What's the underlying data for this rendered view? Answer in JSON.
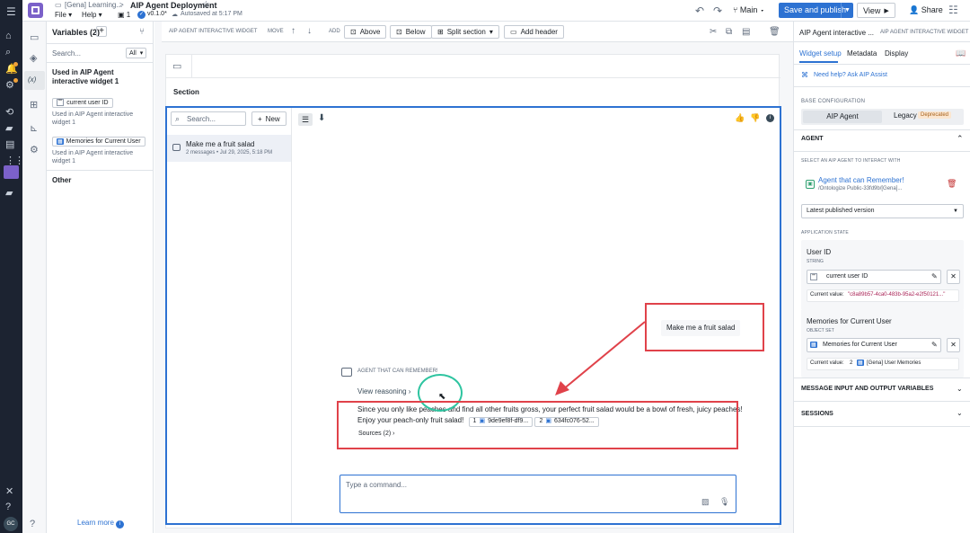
{
  "app": {
    "breadcrumb_parent": "[Gena] Learning...",
    "breadcrumb_sep": ">",
    "page_title": "AIP Agent Deployment",
    "menu_file": "File",
    "menu_help": "Help",
    "pages_count": "1",
    "version": "v0.1.0*",
    "autosave": "Autosaved at 5:17 PM",
    "branch": "Main",
    "save_publish": "Save and publish",
    "view": "View",
    "share": "Share"
  },
  "variables": {
    "header": "Variables (2)",
    "search_placeholder": "Search...",
    "filter": "All",
    "group_title": "Used in AIP Agent interactive widget 1",
    "items": [
      {
        "name": "current user ID",
        "type_icon": "string-icon",
        "used_in_prefix": "Used in",
        "used_in": "AIP Agent interactive widget 1"
      },
      {
        "name": "Memories for Current User",
        "type_icon": "object-set-icon",
        "used_in_prefix": "Used in",
        "used_in": "AIP Agent interactive widget 1"
      }
    ],
    "other": "Other",
    "learn_more": "Learn more"
  },
  "toolbar": {
    "widget_label": "AIP AGENT INTERACTIVE WIDGET",
    "move": "MOVE",
    "add": "ADD",
    "above": "Above",
    "below": "Below",
    "split": "Split section",
    "add_header": "Add header"
  },
  "section": {
    "title": "Section"
  },
  "chat": {
    "search_placeholder": "Search...",
    "new": "New",
    "conversations": [
      {
        "title": "Make me a fruit salad",
        "meta": "2 messages • Jul 29, 2025, 5:18 PM"
      }
    ],
    "user_message": "Make me a fruit salad",
    "agent_name": "AGENT THAT CAN REMEMBER!",
    "view_reasoning": "View reasoning",
    "response_line1": "Since you only like peaches and find all other fruits gross, your perfect fruit salad would be a bowl of fresh, juicy peaches!",
    "response_line2": "Enjoy your peach-only fruit salad!",
    "citations": [
      {
        "num": "1",
        "label": "9de9ef8f-df9..."
      },
      {
        "num": "2",
        "label": "634fc076-52..."
      }
    ],
    "sources": "Sources (2)",
    "input_placeholder": "Type a command..."
  },
  "right": {
    "title": "AIP Agent interactive ...",
    "subtitle": "AIP AGENT INTERACTIVE WIDGET",
    "tabs": [
      "Widget setup",
      "Metadata",
      "Display"
    ],
    "active_tab": 0,
    "need_help": "Need help? Ask AIP Assist",
    "base_config": "BASE CONFIGURATION",
    "seg_aip": "AIP Agent",
    "seg_legacy": "Legacy",
    "deprecated": "Deprecated",
    "agent_section": "AGENT",
    "select_label": "SELECT AN AIP AGENT TO INTERACT WITH",
    "agent_name": "Agent that can Remember!",
    "agent_path": "/Ontologize Public-33fd9b/[Gena]...",
    "version_select": "Latest published version",
    "app_state": "APPLICATION STATE",
    "state_items": [
      {
        "name": "User ID",
        "type": "STRING",
        "var": "current user ID",
        "value_label": "Current value:",
        "value": "\"c8a89b57-4ca0-483b-95a2-e2f50121...\""
      },
      {
        "name": "Memories for Current User",
        "type": "OBJECT SET",
        "var": "Memories for Current User",
        "value_label": "Current value:",
        "value_count": "2",
        "value": "[Gena] User Memories"
      }
    ],
    "msg_io": "MESSAGE INPUT AND OUTPUT VARIABLES",
    "sessions": "SESSIONS"
  },
  "colors": {
    "accent": "#2d72d2",
    "rail": "#1c2331",
    "annotation": "#e0424a",
    "focus_ring": "#2ec4a0"
  },
  "user_avatar": "GC"
}
